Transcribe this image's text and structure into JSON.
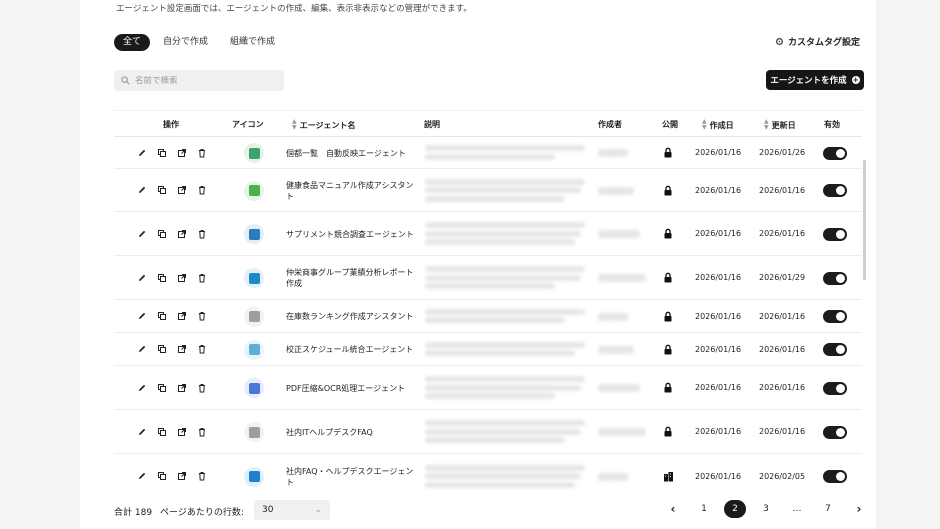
{
  "header": {
    "description": "エージェント設定画面では、エージェントの作成、編集、表示非表示などの管理ができます。"
  },
  "filters": [
    {
      "label": "全て",
      "active": true
    },
    {
      "label": "自分で作成",
      "active": false
    },
    {
      "label": "組織で作成",
      "active": false
    }
  ],
  "custom_tag_label": "カスタムタグ設定",
  "search": {
    "placeholder": "名前で検索",
    "value": ""
  },
  "create_button_label": "エージェントを作成",
  "table": {
    "columns": [
      "操作",
      "アイコン",
      "エージェント名",
      "説明",
      "作成者",
      "公開",
      "作成日",
      "更新日",
      "有効"
    ],
    "rows": [
      {
        "name": "個都一覧　自動反映エージェント",
        "created": "2026/01/16",
        "updated": "2026/01/26",
        "visibility": "lock-icon",
        "enabled": true,
        "icon_color": "#3aa56a"
      },
      {
        "name": "健康食品マニュアル作成アシスタント",
        "created": "2026/01/16",
        "updated": "2026/01/16",
        "visibility": "lock-icon",
        "enabled": true,
        "icon_color": "#4caf50"
      },
      {
        "name": "サプリメント競合調査エージェント",
        "created": "2026/01/16",
        "updated": "2026/01/16",
        "visibility": "lock-icon",
        "enabled": true,
        "icon_color": "#2b7bbf"
      },
      {
        "name": "仲栄商事グループ業績分析レポート作成",
        "created": "2026/01/16",
        "updated": "2026/01/29",
        "visibility": "lock-icon",
        "enabled": true,
        "icon_color": "#1e88c8"
      },
      {
        "name": "在庫数ランキング作成アシスタント",
        "created": "2026/01/16",
        "updated": "2026/01/16",
        "visibility": "lock-icon",
        "enabled": true,
        "icon_color": "#9e9e9e"
      },
      {
        "name": "校正スケジュール統合エージェント",
        "created": "2026/01/16",
        "updated": "2026/01/16",
        "visibility": "lock-icon",
        "enabled": true,
        "icon_color": "#5bb0d8"
      },
      {
        "name": "PDF圧縮&OCR処理エージェント",
        "created": "2026/01/16",
        "updated": "2026/01/16",
        "visibility": "lock-icon",
        "enabled": true,
        "icon_color": "#4a78d8"
      },
      {
        "name": "社内ITヘルプデスクFAQ",
        "created": "2026/01/16",
        "updated": "2026/01/16",
        "visibility": "lock-icon",
        "enabled": true,
        "icon_color": "#9e9e9e"
      },
      {
        "name": "社内FAQ・ヘルプデスクエージェント",
        "created": "2026/01/16",
        "updated": "2026/02/05",
        "visibility": "building-icon",
        "enabled": true,
        "icon_color": "#1e7fd0"
      }
    ]
  },
  "footer": {
    "total": "合計 189",
    "rows_per_page_label": "ページあたりの行数:",
    "rows_per_page_value": "30",
    "pages": [
      "1",
      "2",
      "3",
      "…",
      "7"
    ],
    "current_page": "2",
    "prev_glyph": "‹",
    "next_glyph": "›"
  }
}
